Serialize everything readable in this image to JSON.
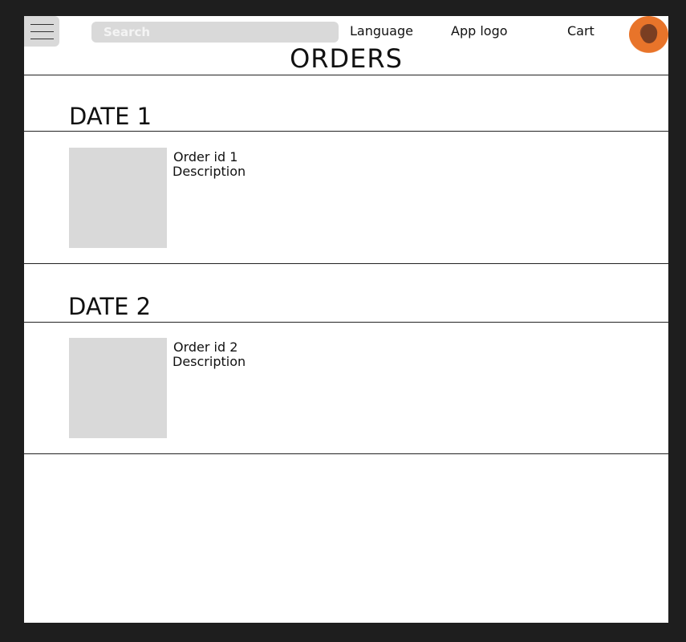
{
  "header": {
    "menu_icon": "hamburger-menu-icon",
    "search": {
      "placeholder": "Search",
      "value": ""
    },
    "language_label": "Language",
    "app_logo_label": "App logo",
    "cart_label": "Cart",
    "avatar_icon": "user-avatar"
  },
  "page": {
    "title": "ORDERS"
  },
  "orders": [
    {
      "date": "DATE 1",
      "order_id": "Order id 1",
      "description": "Description"
    },
    {
      "date": "DATE 2",
      "order_id": "Order id 2",
      "description": "Description"
    }
  ],
  "colors": {
    "background": "#1e1e1e",
    "surface": "#ffffff",
    "placeholder_gray": "#d9d9d9",
    "text": "#111111"
  }
}
